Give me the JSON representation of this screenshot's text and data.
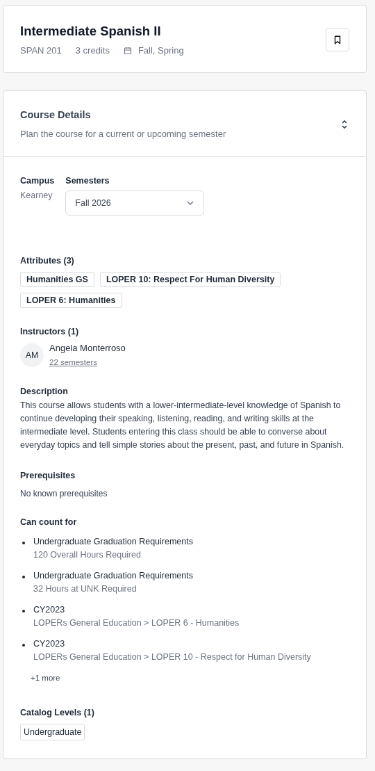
{
  "course": {
    "title": "Intermediate Spanish II",
    "code": "SPAN 201",
    "credits": "3 credits",
    "terms": "Fall, Spring"
  },
  "details": {
    "title": "Course Details",
    "subtitle": "Plan the course for a current or upcoming semester",
    "campus": {
      "label": "Campus",
      "value": "Kearney"
    },
    "semesters": {
      "label": "Semesters",
      "value": "Fall 2026"
    },
    "attributes": {
      "heading": "Attributes (3)",
      "tags": [
        "Humanities GS",
        "LOPER 10: Respect For Human Diversity",
        "LOPER 6: Humanities"
      ]
    },
    "instructors": {
      "heading": "Instructors (1)",
      "items": [
        {
          "initials": "AM",
          "name": "Angela Monterroso",
          "link": "22 semesters"
        }
      ]
    },
    "description": {
      "heading": "Description",
      "text": "This course allows students with a lower-intermediate-level knowledge of Spanish to continue developing their speaking, listening, reading, and writing skills at the intermediate level. Students entering this class should be able to converse about everyday topics and tell simple stories about the present, past, and future in Spanish."
    },
    "prerequisites": {
      "heading": "Prerequisites",
      "text": "No known prerequisites"
    },
    "can_count_for": {
      "heading": "Can count for",
      "items": [
        {
          "title": "Undergraduate Graduation Requirements",
          "detail": "120 Overall Hours Required"
        },
        {
          "title": "Undergraduate Graduation Requirements",
          "detail": "32 Hours at UNK Required"
        },
        {
          "title": "CY2023",
          "detail": "LOPERs General Education > LOPER 6 - Humanities"
        },
        {
          "title": "CY2023",
          "detail": "LOPERs General Education > LOPER 10 - Respect for Human Diversity"
        }
      ],
      "more": "+1 more"
    },
    "catalog_levels": {
      "heading": "Catalog Levels (1)",
      "tags": [
        "Undergraduate"
      ]
    }
  }
}
